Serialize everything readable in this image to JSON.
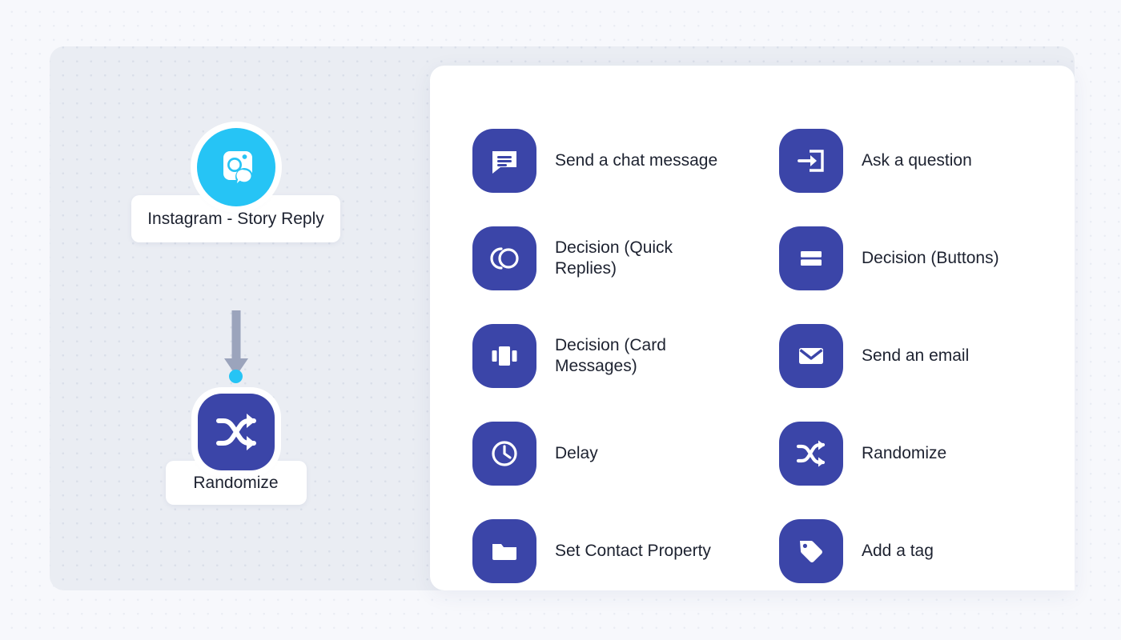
{
  "colors": {
    "page_background": "#f7f8fc",
    "canvas_background": "#eaedf3",
    "panel_background": "#ffffff",
    "trigger_accent": "#26c4f5",
    "action_accent": "#3b45a8",
    "connector": "#9ba4bc",
    "text": "#1d2230"
  },
  "flow": {
    "trigger": {
      "label": "Instagram - Story Reply",
      "icon": "instagram-camera-chat-icon",
      "accent": "#26c4f5"
    },
    "connector": {
      "arrow_icon": "down-arrow-icon",
      "endpoint_icon": "connector-dot-icon"
    },
    "action": {
      "label": "Randomize",
      "icon": "shuffle-icon",
      "accent": "#3b45a8"
    }
  },
  "menu": {
    "items": [
      {
        "label": "Send a chat message",
        "icon": "chat-bubble-lines-icon",
        "column": 1,
        "row": 1
      },
      {
        "label": "Ask a question",
        "icon": "arrow-into-box-icon",
        "column": 2,
        "row": 1
      },
      {
        "label": "Decision (Quick Replies)",
        "icon": "arc-circle-icon",
        "column": 1,
        "row": 2
      },
      {
        "label": "Decision (Buttons)",
        "icon": "two-bars-icon",
        "column": 2,
        "row": 2
      },
      {
        "label": "Decision (Card Messages)",
        "icon": "carousel-cards-icon",
        "column": 1,
        "row": 3
      },
      {
        "label": "Send an email",
        "icon": "envelope-icon",
        "column": 2,
        "row": 3
      },
      {
        "label": "Delay",
        "icon": "clock-icon",
        "column": 1,
        "row": 4
      },
      {
        "label": "Randomize",
        "icon": "shuffle-icon",
        "column": 2,
        "row": 4
      },
      {
        "label": "Set Contact Property",
        "icon": "folder-icon",
        "column": 1,
        "row": 5
      },
      {
        "label": "Add a tag",
        "icon": "tag-icon",
        "column": 2,
        "row": 5
      }
    ]
  }
}
